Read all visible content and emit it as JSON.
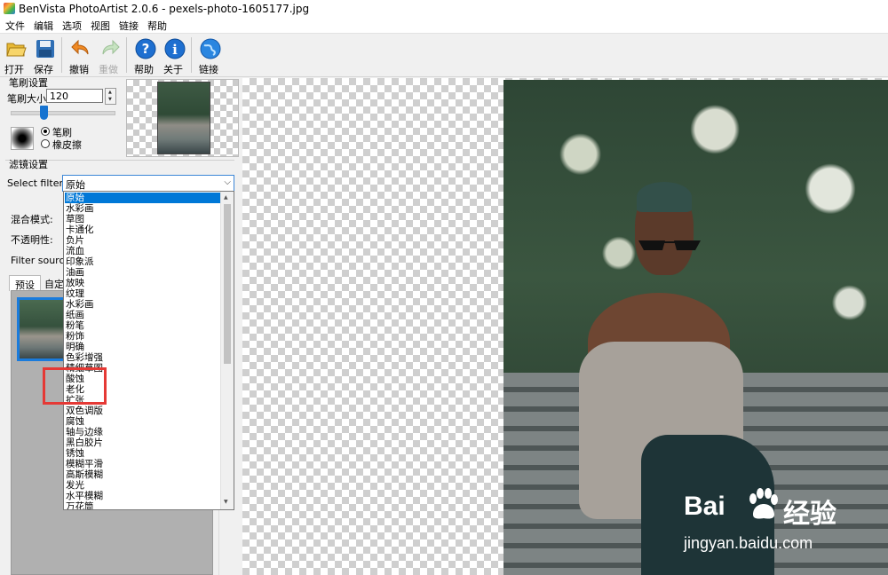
{
  "window": {
    "title": "BenVista PhotoArtist 2.0.6 - pexels-photo-1605177.jpg"
  },
  "menu": [
    "文件",
    "编辑",
    "选项",
    "视图",
    "链接",
    "帮助"
  ],
  "toolbar": {
    "open": "打开",
    "save": "保存",
    "undo": "撤销",
    "redo": "重做",
    "help": "帮助",
    "about": "关于",
    "link": "链接"
  },
  "brush_settings": {
    "group_label": "笔刷设置",
    "size_label": "笔刷大小:",
    "size_value": "120",
    "size_slider_fraction": 0.3,
    "mode_brush": "笔刷",
    "mode_eraser": "橡皮擦"
  },
  "filter_settings": {
    "group_label": "滤镜设置",
    "select_label": "Select filter:",
    "selected": "原始",
    "blend_label": "混合模式:",
    "opacity_label": "不透明性:",
    "source_label": "Filter source:",
    "tabs": [
      "预设",
      "自定"
    ]
  },
  "dropdown_items": [
    "原始",
    "水彩画",
    "草图",
    "卡通化",
    "负片",
    "流血",
    "印象派",
    "油画",
    "放映",
    "纹理",
    "水彩画",
    "纸画",
    "粉笔",
    "粉饰",
    "明确",
    "色彩增强",
    "精细草图",
    "酸蚀",
    "老化",
    "扩张",
    "双色调版",
    "腐蚀",
    "轴与边缘",
    "黑白胶片",
    "锈蚀",
    "模糊平滑",
    "高斯模糊",
    "发光",
    "水平模糊",
    "万花筒"
  ],
  "watermark": {
    "brand": "Bai",
    "brand_cn": "经验",
    "url": "jingyan.baidu.com"
  },
  "colors": {
    "accent": "#0078d7",
    "highlight": "#e53935"
  }
}
